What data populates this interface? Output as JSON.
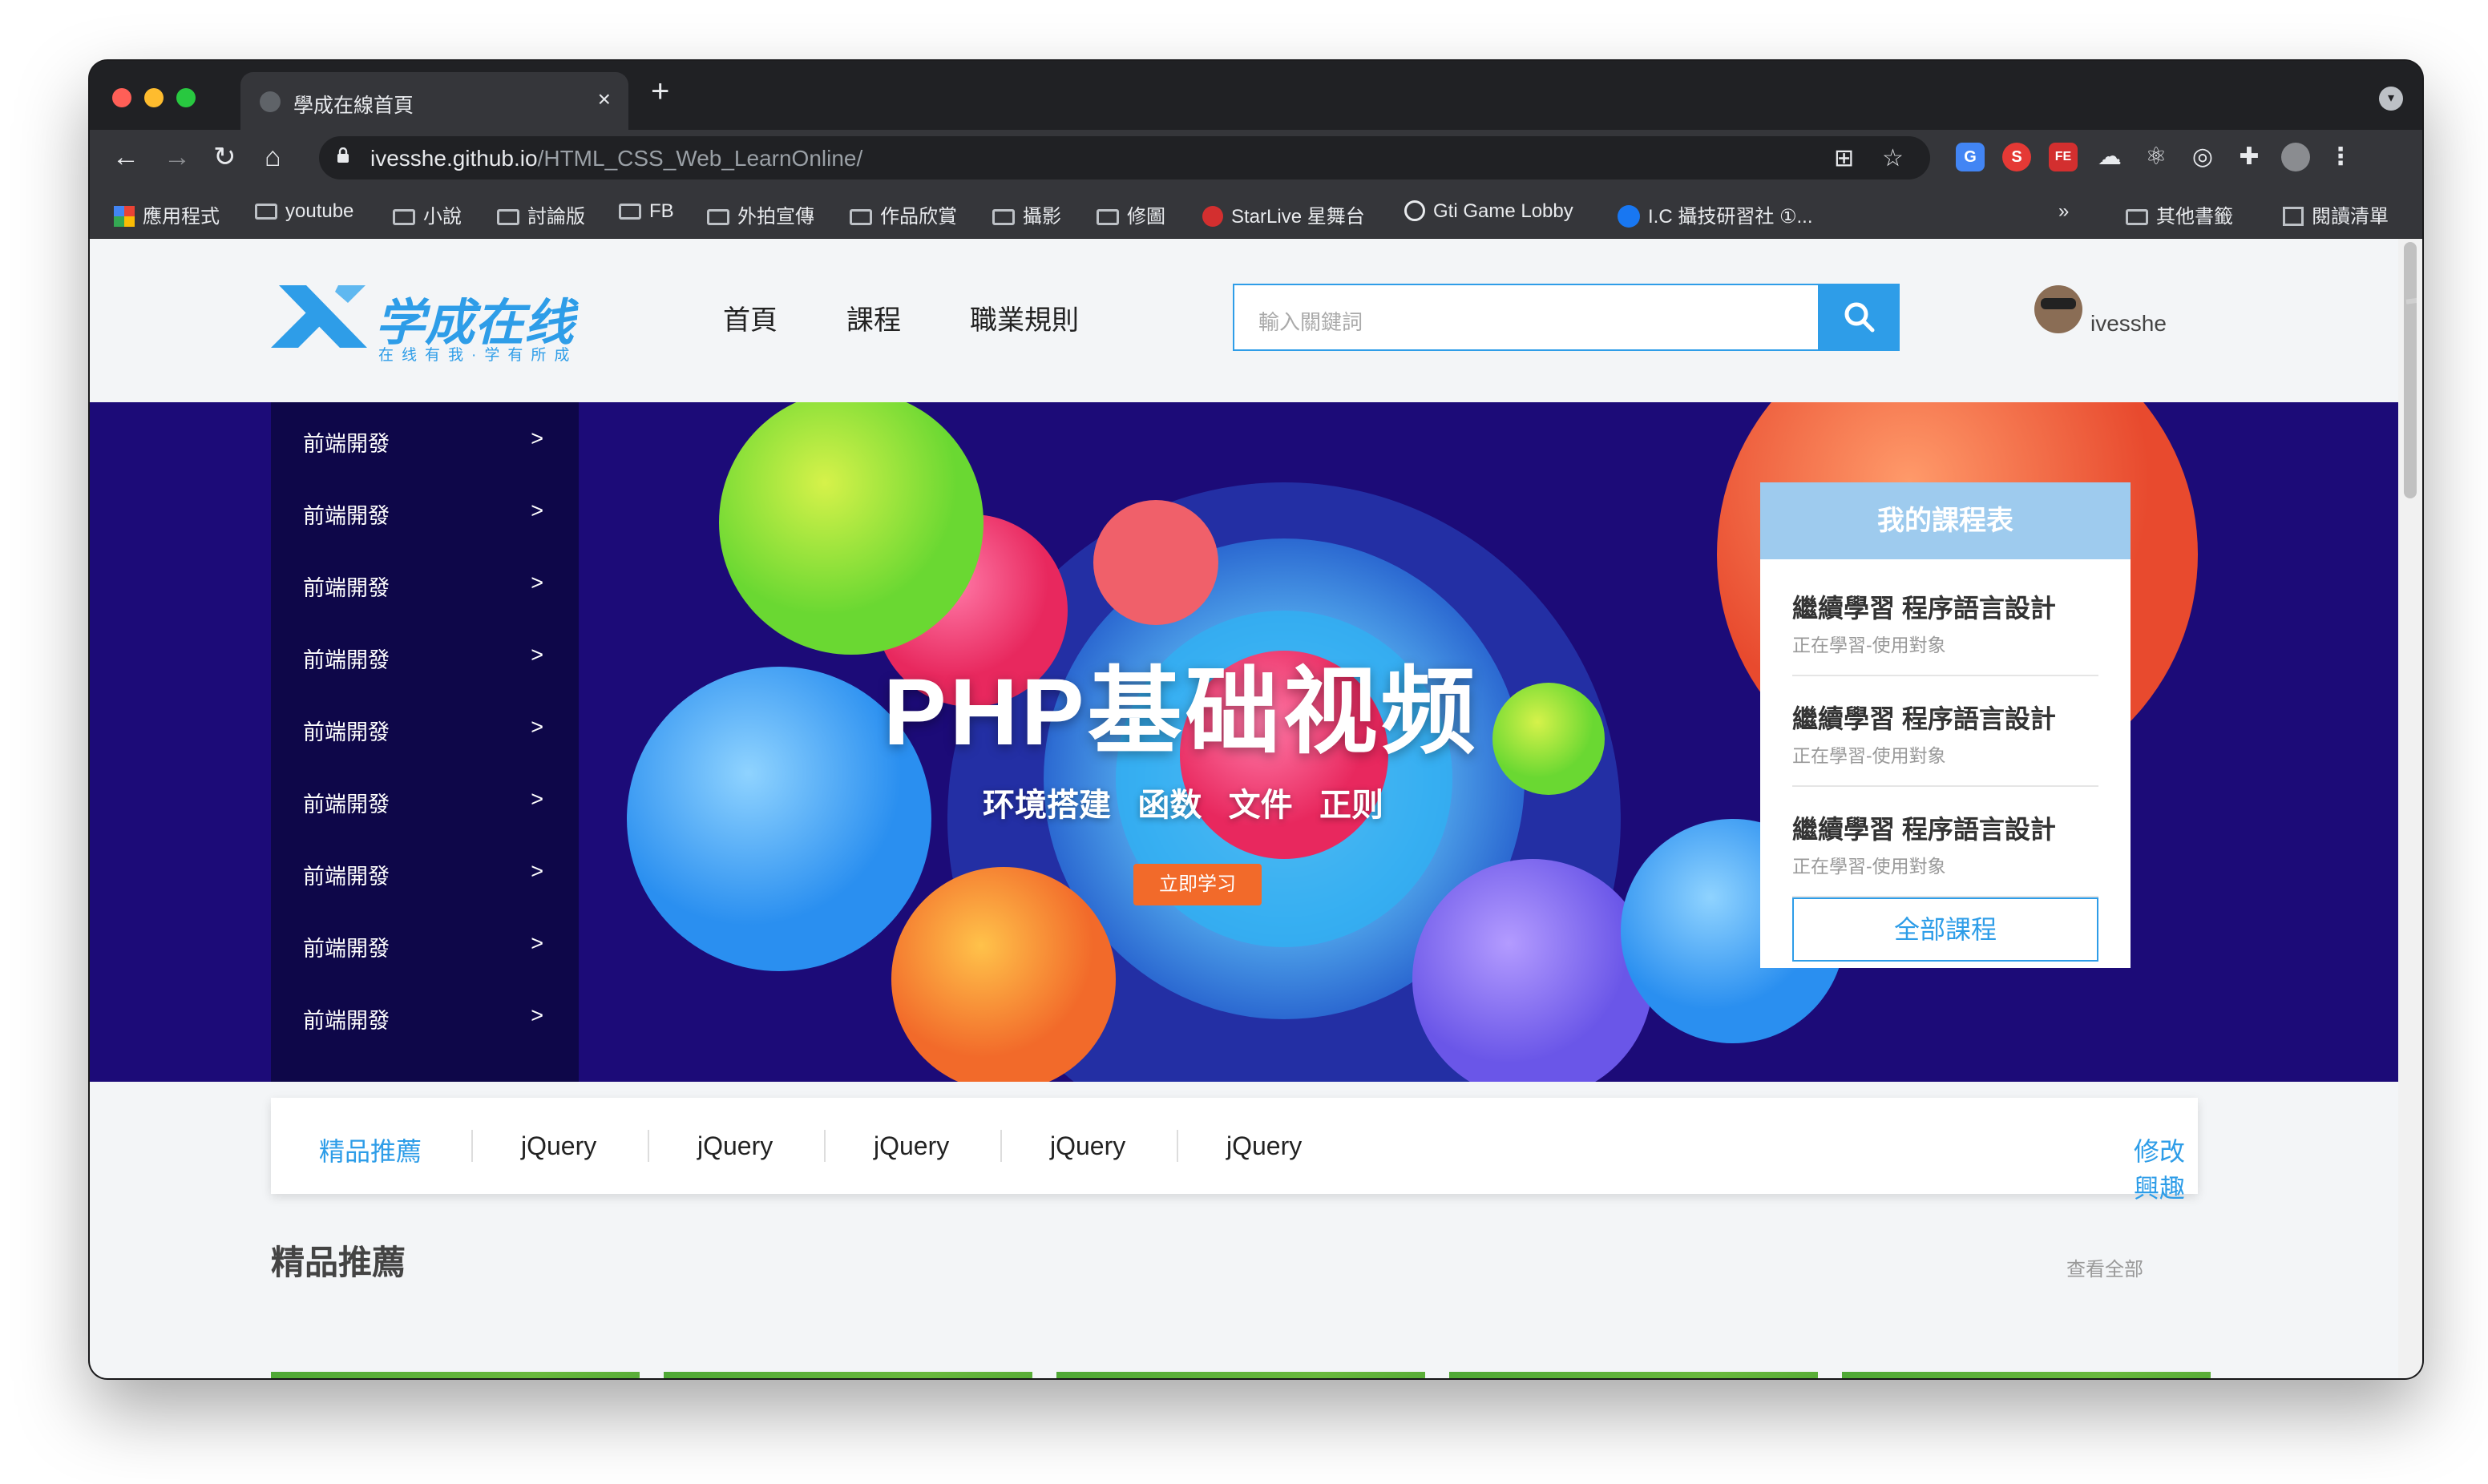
{
  "browser": {
    "tab_title": "學成在線首頁",
    "tab_close": "×",
    "new_tab": "+",
    "url_host": "ivesshe.github.io",
    "url_path": "/HTML_CSS_Web_LearnOnline/",
    "bookmarks": [
      "應用程式",
      "youtube",
      "小說",
      "討論版",
      "FB",
      "外拍宣傳",
      "作品欣賞",
      "攝影",
      "修圖",
      "StarLive 星舞台",
      "Gti Game Lobby",
      "I.C 攝技研習社 ①..."
    ],
    "more_bookmarks": "»",
    "other_bookmarks": "其他書籤",
    "reading_list": "閱讀清單",
    "colors": {
      "titlebar": "#202124",
      "toolbar": "#35363a"
    }
  },
  "site": {
    "brand": "学成在线",
    "slogan": "在线有我·学有所成",
    "nav": [
      "首頁",
      "課程",
      "職業規則"
    ],
    "search_placeholder": "輸入關鍵詞",
    "username": "ivesshe",
    "accent": "#2e9de8"
  },
  "banner": {
    "headline": "PHP基础视频",
    "tags": "环境搭建   函数   文件   正则",
    "cta": "立即学习",
    "sidebar_items": [
      "前端開發",
      "前端開發",
      "前端開發",
      "前端開發",
      "前端開發",
      "前端開發",
      "前端開發",
      "前端開發",
      "前端開發"
    ],
    "sidebar_arrow": ">"
  },
  "course_card": {
    "title": "我的課程表",
    "items": [
      {
        "title": "繼續學習 程序語言設計",
        "sub": "正在學習-使用對象"
      },
      {
        "title": "繼續學習 程序語言設計",
        "sub": "正在學習-使用對象"
      },
      {
        "title": "繼續學習 程序語言設計",
        "sub": "正在學習-使用對象"
      }
    ],
    "all_button": "全部課程"
  },
  "categories": {
    "featured": "精品推薦",
    "items": [
      "jQuery",
      "jQuery",
      "jQuery",
      "jQuery",
      "jQuery"
    ],
    "edit": "修改興趣"
  },
  "section": {
    "title": "精品推薦",
    "see_all": "查看全部"
  }
}
